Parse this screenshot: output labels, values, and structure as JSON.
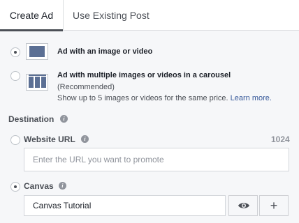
{
  "tabs": {
    "create_ad": "Create Ad",
    "use_existing_post": "Use Existing Post"
  },
  "formats": {
    "single": {
      "title": "Ad with an image or video",
      "selected": true,
      "icon": "single-image-icon"
    },
    "carousel": {
      "title": "Ad with multiple images or videos in a carousel",
      "recommended": "(Recommended)",
      "description": "Show up to 5 images or videos for the same price.",
      "learn_more": "Learn more.",
      "selected": false,
      "icon": "carousel-icon"
    }
  },
  "destination": {
    "label": "Destination",
    "website_url": {
      "label": "Website URL",
      "char_count": "1024",
      "placeholder": "Enter the URL you want to promote",
      "selected": false
    },
    "canvas": {
      "label": "Canvas",
      "value": "Canvas Tutorial",
      "selected": true,
      "preview_icon": "eye-icon",
      "add_icon": "plus-icon",
      "add_glyph": "+"
    }
  },
  "colors": {
    "link": "#365899",
    "thumb_fill": "#5b6f94",
    "active_tab_underline": "#4b4f56"
  }
}
